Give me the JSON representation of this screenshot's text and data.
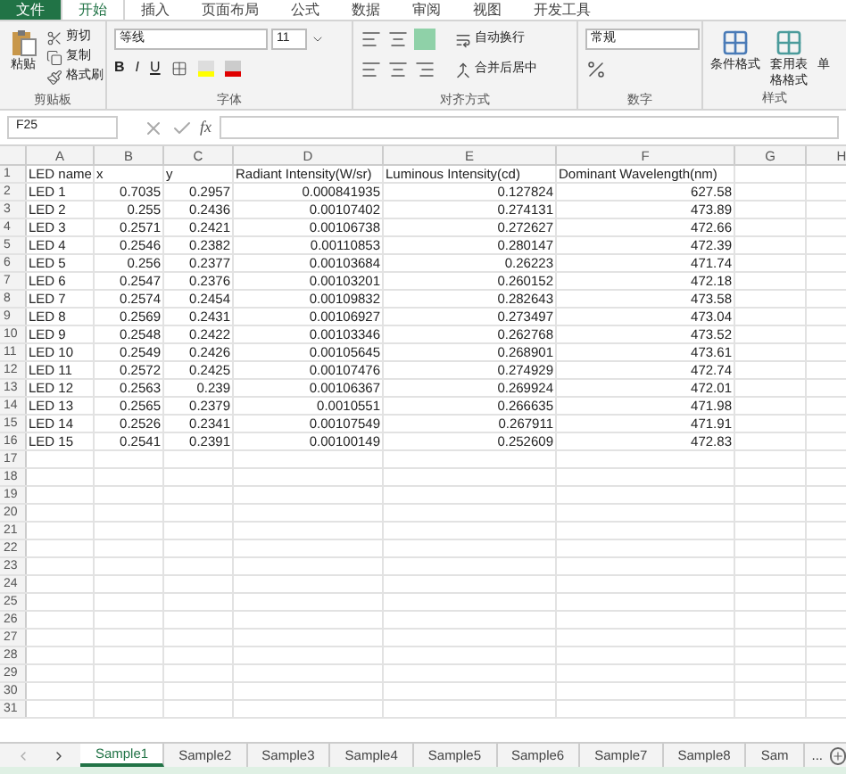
{
  "ribbon_tabs": [
    {
      "label": "文件",
      "selected": false,
      "kind": "file"
    },
    {
      "label": "开始",
      "selected": true,
      "kind": "tab"
    },
    {
      "label": "插入",
      "selected": false,
      "kind": "tab"
    },
    {
      "label": "页面布局",
      "selected": false,
      "kind": "tab"
    },
    {
      "label": "公式",
      "selected": false,
      "kind": "tab"
    },
    {
      "label": "数据",
      "selected": false,
      "kind": "tab"
    },
    {
      "label": "审阅",
      "selected": false,
      "kind": "tab"
    },
    {
      "label": "视图",
      "selected": false,
      "kind": "tab"
    },
    {
      "label": "开发工具",
      "selected": false,
      "kind": "tab"
    }
  ],
  "clipboard": {
    "paste": "粘贴",
    "cut": "剪切",
    "copy": "复制",
    "format_painter": "格式刷",
    "label": "剪贴板"
  },
  "font": {
    "name": "等线",
    "size": "11",
    "bold": "B",
    "italic": "I",
    "underline": "U",
    "label": "字体"
  },
  "formula_icon": "fx",
  "alignment": {
    "wrap": "自动换行",
    "merge": "合并后居中",
    "label": "对齐方式"
  },
  "number": {
    "format": "常规",
    "label": "数字"
  },
  "styles": {
    "conditional": "条件格式",
    "table": "套用表格格式",
    "cell": "单",
    "label": "样式"
  },
  "name_box": "F25",
  "columns": [
    "A",
    "B",
    "C",
    "D",
    "E",
    "F",
    "G",
    "H"
  ],
  "rows": [
    [
      "LED name",
      "x",
      "y",
      "Radiant Intensity(W/sr)",
      "Luminous Intensity(cd)",
      "Dominant Wavelength(nm)"
    ],
    [
      "LED 1",
      "0.7035",
      "0.2957",
      "0.000841935",
      "0.127824",
      "627.58"
    ],
    [
      "LED 2",
      "0.255",
      "0.2436",
      "0.00107402",
      "0.274131",
      "473.89"
    ],
    [
      "LED 3",
      "0.2571",
      "0.2421",
      "0.00106738",
      "0.272627",
      "472.66"
    ],
    [
      "LED 4",
      "0.2546",
      "0.2382",
      "0.00110853",
      "0.280147",
      "472.39"
    ],
    [
      "LED 5",
      "0.256",
      "0.2377",
      "0.00103684",
      "0.26223",
      "471.74"
    ],
    [
      "LED 6",
      "0.2547",
      "0.2376",
      "0.00103201",
      "0.260152",
      "472.18"
    ],
    [
      "LED 7",
      "0.2574",
      "0.2454",
      "0.00109832",
      "0.282643",
      "473.58"
    ],
    [
      "LED 8",
      "0.2569",
      "0.2431",
      "0.00106927",
      "0.273497",
      "473.04"
    ],
    [
      "LED 9",
      "0.2548",
      "0.2422",
      "0.00103346",
      "0.262768",
      "473.52"
    ],
    [
      "LED 10",
      "0.2549",
      "0.2426",
      "0.00105645",
      "0.268901",
      "473.61"
    ],
    [
      "LED 11",
      "0.2572",
      "0.2425",
      "0.00107476",
      "0.274929",
      "472.74"
    ],
    [
      "LED 12",
      "0.2563",
      "0.239",
      "0.00106367",
      "0.269924",
      "472.01"
    ],
    [
      "LED 13",
      "0.2565",
      "0.2379",
      "0.0010551",
      "0.266635",
      "471.98"
    ],
    [
      "LED 14",
      "0.2526",
      "0.2341",
      "0.00107549",
      "0.267911",
      "471.91"
    ],
    [
      "LED 15",
      "0.2541",
      "0.2391",
      "0.00100149",
      "0.252609",
      "472.83"
    ]
  ],
  "row_numbers": [
    "1",
    "2",
    "3",
    "4",
    "5",
    "6",
    "7",
    "8",
    "9",
    "10",
    "11",
    "12",
    "13",
    "14",
    "15",
    "16",
    "17",
    "18",
    "19",
    "20",
    "21",
    "22",
    "23",
    "24",
    "25",
    "26",
    "27",
    "28",
    "29",
    "30",
    "31"
  ],
  "sheet_tabs": [
    {
      "label": "Sample1",
      "selected": true
    },
    {
      "label": "Sample2",
      "selected": false
    },
    {
      "label": "Sample3",
      "selected": false
    },
    {
      "label": "Sample4",
      "selected": false
    },
    {
      "label": "Sample5",
      "selected": false
    },
    {
      "label": "Sample6",
      "selected": false
    },
    {
      "label": "Sample7",
      "selected": false
    },
    {
      "label": "Sample8",
      "selected": false
    },
    {
      "label": "Sam",
      "selected": false
    }
  ],
  "more_tabs": "..."
}
